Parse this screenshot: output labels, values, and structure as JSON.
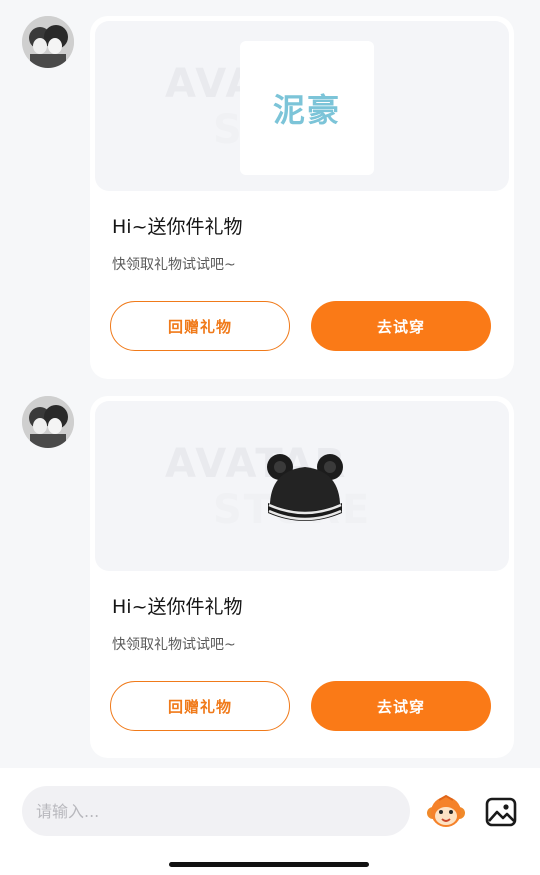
{
  "messages": [
    {
      "title": "Hi~送你件礼物",
      "subtitle": "快领取礼物试试吧~",
      "gift_label": "泥豪",
      "watermark": [
        "AVATAR",
        "STORE"
      ],
      "reply_button": "回赠礼物",
      "try_button": "去试穿"
    },
    {
      "title": "Hi~送你件礼物",
      "subtitle": "快领取礼物试试吧~",
      "watermark": [
        "AVATAR",
        "STORE"
      ],
      "reply_button": "回赠礼物",
      "try_button": "去试穿"
    }
  ],
  "input": {
    "placeholder": "请输入..."
  },
  "colors": {
    "accent": "#fa7a17",
    "background": "#f6f7f9",
    "card": "#ffffff"
  },
  "icons": [
    "avatar",
    "sticker-monkey-icon",
    "image-icon"
  ]
}
